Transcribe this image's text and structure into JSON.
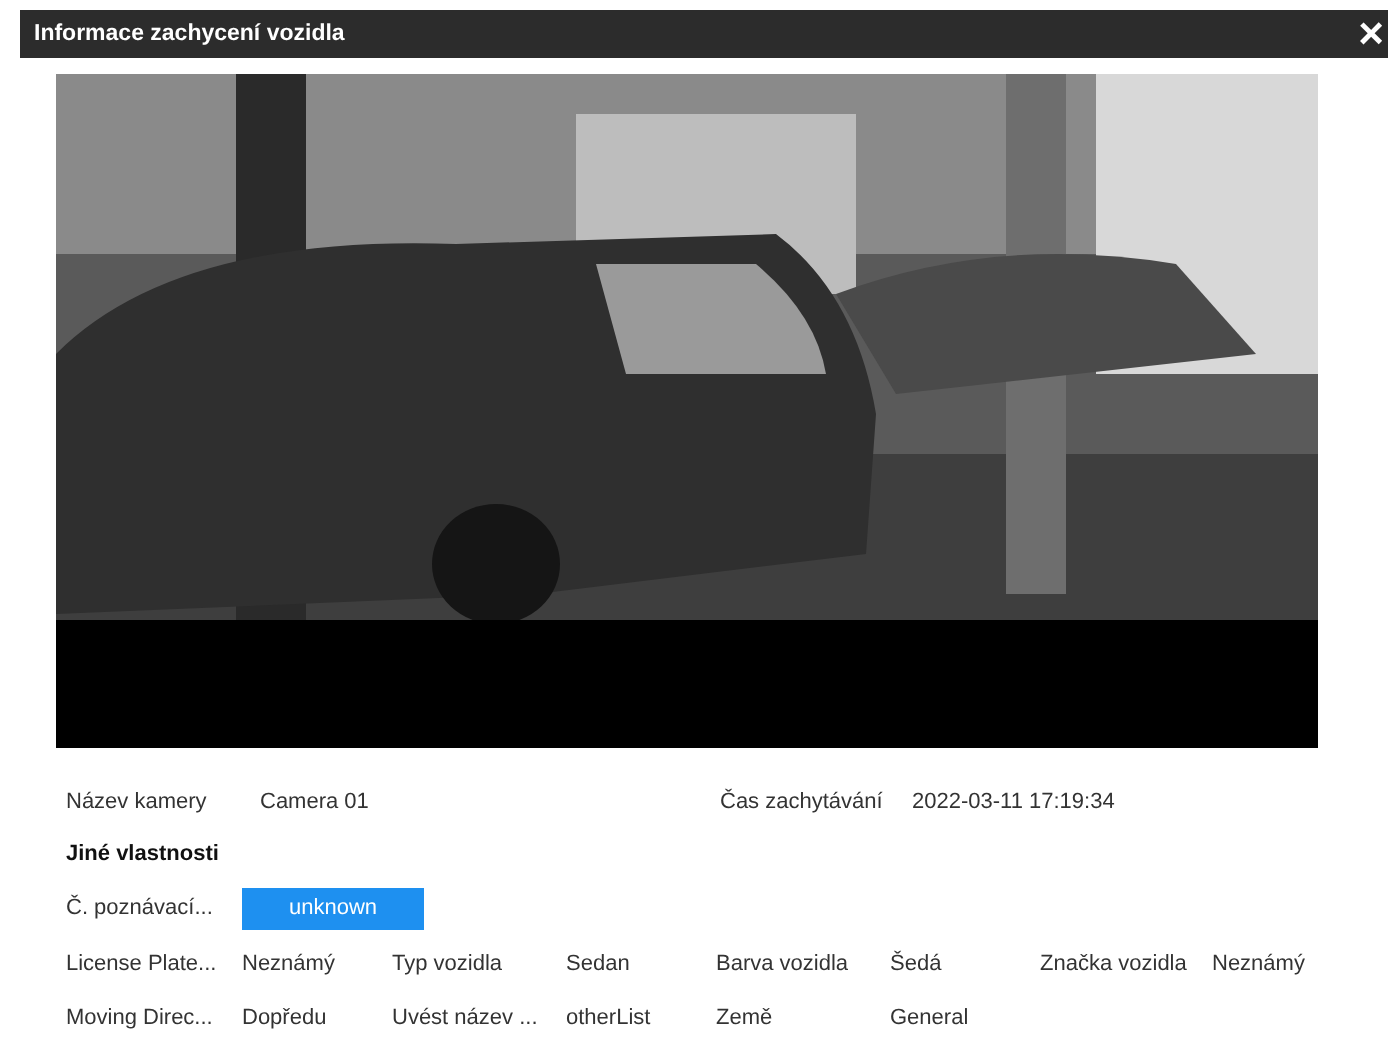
{
  "dialog": {
    "title": "Informace zachycení vozidla",
    "close": "×"
  },
  "camera_row": [
    {
      "label": "Název kamery",
      "value": "Camera 01"
    },
    {
      "label": "Čas zachytávání",
      "value": "2022-03-11 17:19:34"
    }
  ],
  "section_title": "Jiné vlastnosti",
  "plate": {
    "label": "Č. poznávací...",
    "value": "unknown"
  },
  "properties": [
    {
      "label": "License Plate...",
      "value": "Neznámý"
    },
    {
      "label": "Typ vozidla",
      "value": "Sedan"
    },
    {
      "label": "Barva vozidla",
      "value": "Šedá"
    },
    {
      "label": "Značka vozidla",
      "value": "Neznámý"
    },
    {
      "label": "Moving Direc...",
      "value": "Dopředu"
    },
    {
      "label": "Uvést název ...",
      "value": "otherList"
    },
    {
      "label": "Země",
      "value": "General"
    }
  ]
}
